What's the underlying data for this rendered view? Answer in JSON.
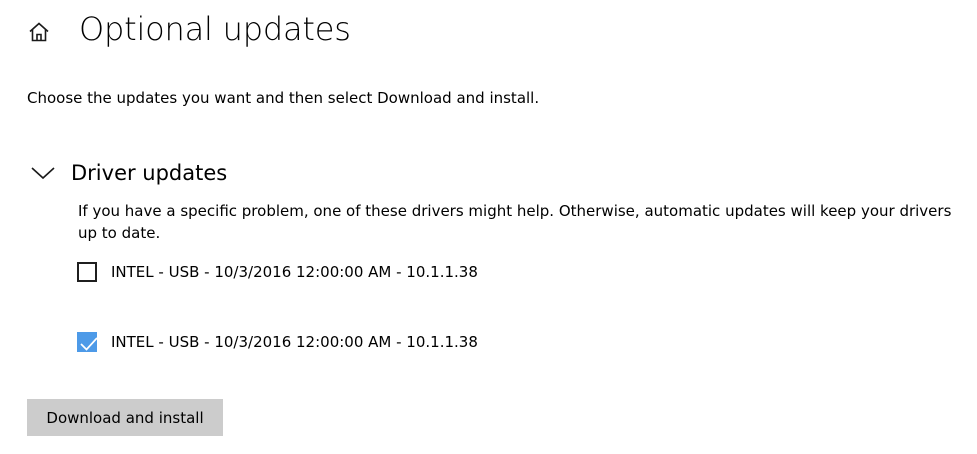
{
  "header": {
    "home_icon": "home-icon",
    "title": "Optional updates"
  },
  "description": "Choose the updates you want and then select Download and install.",
  "driver_section": {
    "expanded": true,
    "chevron_icon": "chevron-down-icon",
    "title": "Driver updates",
    "description": "If you have a specific problem, one of these drivers might help. Otherwise, automatic updates will keep your drivers up to date.",
    "updates": [
      {
        "label": "INTEL - USB - 10/3/2016 12:00:00 AM - 10.1.1.38",
        "checked": false
      },
      {
        "label": "INTEL - USB - 10/3/2016 12:00:00 AM - 10.1.1.38",
        "checked": true
      }
    ]
  },
  "actions": {
    "download_install_label": "Download and install"
  },
  "colors": {
    "accent": "#4d9ae8",
    "button_bg": "#cccccc",
    "text": "#000000",
    "background": "#ffffff"
  }
}
